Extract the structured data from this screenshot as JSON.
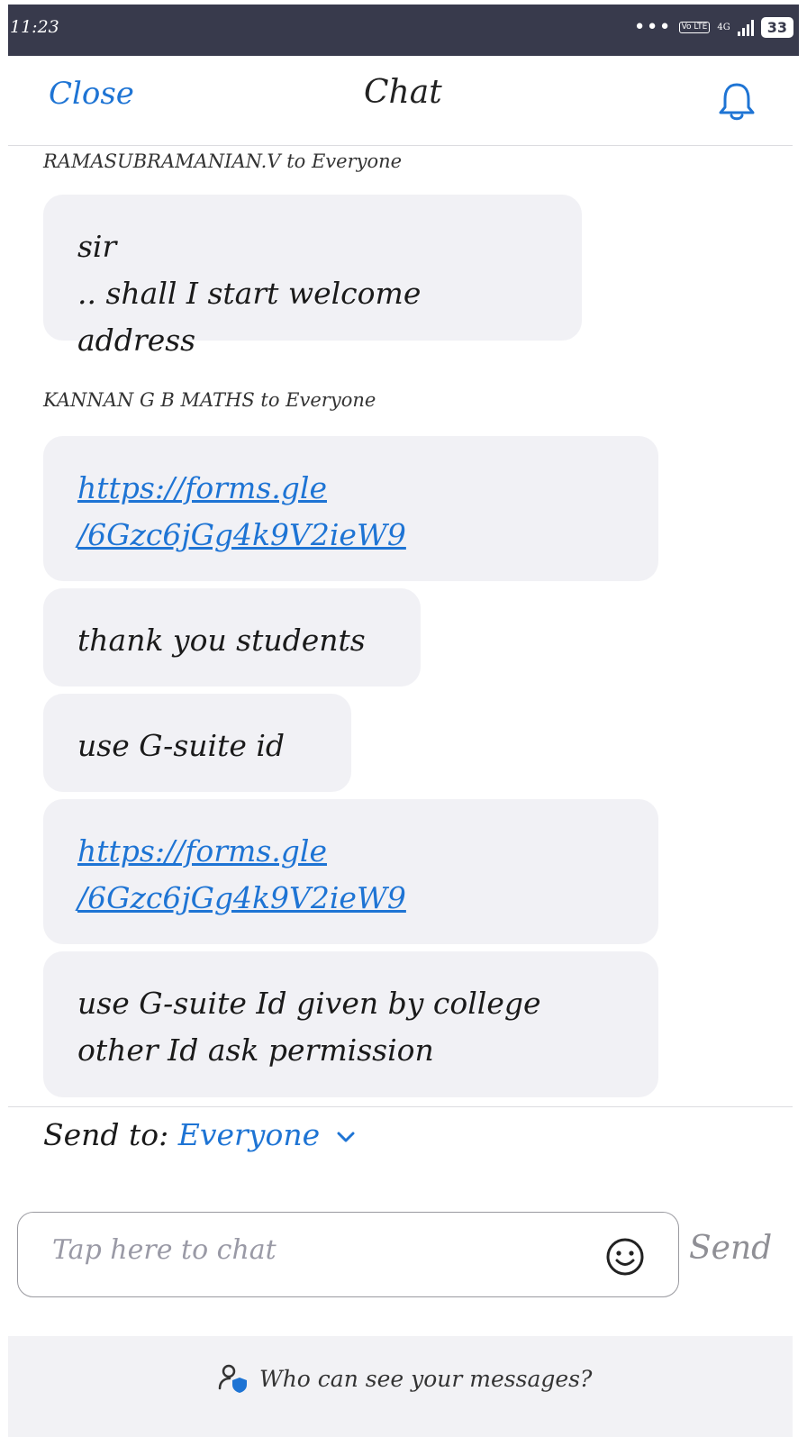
{
  "status_bar": {
    "time": "11:23",
    "network": "4G",
    "volte": "Vo LTE",
    "battery": "33"
  },
  "header": {
    "close_label": "Close",
    "title": "Chat"
  },
  "messages": [
    {
      "sender": "RAMASUBRAMANIAN.V to Everyone",
      "bubbles": [
        {
          "lines": [
            "sir",
            ".. shall I start welcome address"
          ],
          "is_link": false
        }
      ]
    },
    {
      "sender": "KANNAN G B MATHS to Everyone",
      "bubbles": [
        {
          "lines": [
            "https://forms.gle",
            "/6Gzc6jGg4k9V2ieW9"
          ],
          "is_link": true
        },
        {
          "lines": [
            "thank you students"
          ],
          "is_link": false
        },
        {
          "lines": [
            "use G-suite id"
          ],
          "is_link": false
        },
        {
          "lines": [
            "https://forms.gle",
            "/6Gzc6jGg4k9V2ieW9"
          ],
          "is_link": true
        },
        {
          "lines": [
            "use G-suite Id given by college",
            "other Id ask permission"
          ],
          "is_link": false
        }
      ]
    }
  ],
  "send_to": {
    "label": "Send to:",
    "target": "Everyone"
  },
  "input": {
    "placeholder": "Tap here to chat"
  },
  "send_button": "Send",
  "footer": {
    "text": "Who can see your messages?"
  },
  "colors": {
    "accent": "#1e74d4",
    "status_bar": "#383a4c",
    "bubble": "#f1f1f5"
  }
}
